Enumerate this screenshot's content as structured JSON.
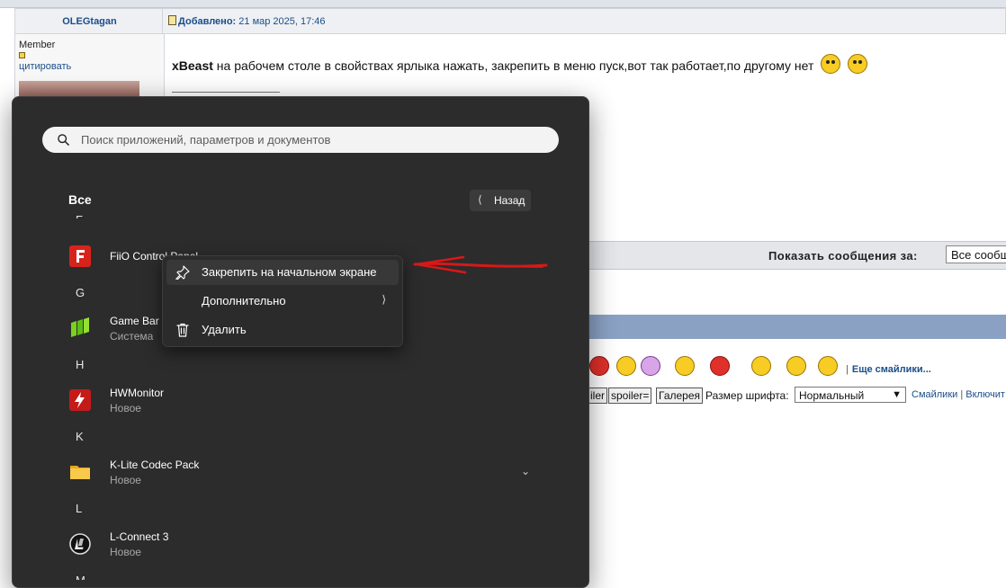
{
  "forum": {
    "author": "OLEGtagan",
    "date_prefix": "Добавлено:",
    "date_value": "21 мар 2025, 17:46",
    "member_rank": "Member",
    "quote_link": "цитировать",
    "post_bold": "xBeast",
    "post_text": " на рабочем столе в свойствах ярлыка нажать, закрепить в меню пуск,вот так работает,по другому нет",
    "show_messages_label": "Показать сообщения за:",
    "show_messages_value": "Все сообщ",
    "more_smilies": "Еще смайлики...",
    "more_smilies_sep": "|",
    "format_buttons": [
      "iler",
      "spoiler=",
      "Галерея"
    ],
    "font_size_label": "Размер шрифта:",
    "font_size_value": "Нормальный",
    "links": [
      "Смайлики",
      "Включит"
    ],
    "links_sep": "|"
  },
  "start_menu": {
    "search_placeholder": "Поиск приложений, параметров и документов",
    "all_label": "Все",
    "back_label": "Назад",
    "letters": [
      "F",
      "G",
      "H",
      "K",
      "L",
      "M"
    ],
    "apps": [
      {
        "name": "FiiO Control Panel",
        "sub": "",
        "icon": "fiio-icon"
      },
      {
        "name": "Game Bar",
        "sub": "Система",
        "icon": "game-bar-icon"
      },
      {
        "name": "HWMonitor",
        "sub": "Новое",
        "icon": "hwmonitor-icon"
      },
      {
        "name": "K-Lite Codec Pack",
        "sub": "Новое",
        "icon": "folder-icon"
      },
      {
        "name": "L-Connect 3",
        "sub": "Новое",
        "icon": "lconnect-icon"
      }
    ]
  },
  "context_menu": {
    "items": [
      {
        "label": "Закрепить на начальном экране",
        "icon": "pin-icon"
      },
      {
        "label": "Дополнительно",
        "icon": ""
      },
      {
        "label": "Удалить",
        "icon": "trash-icon"
      }
    ]
  },
  "colors": {
    "menu_bg": "#2c2c2c",
    "annotation_red": "#d81818",
    "forum_link": "#1a4e8a"
  }
}
